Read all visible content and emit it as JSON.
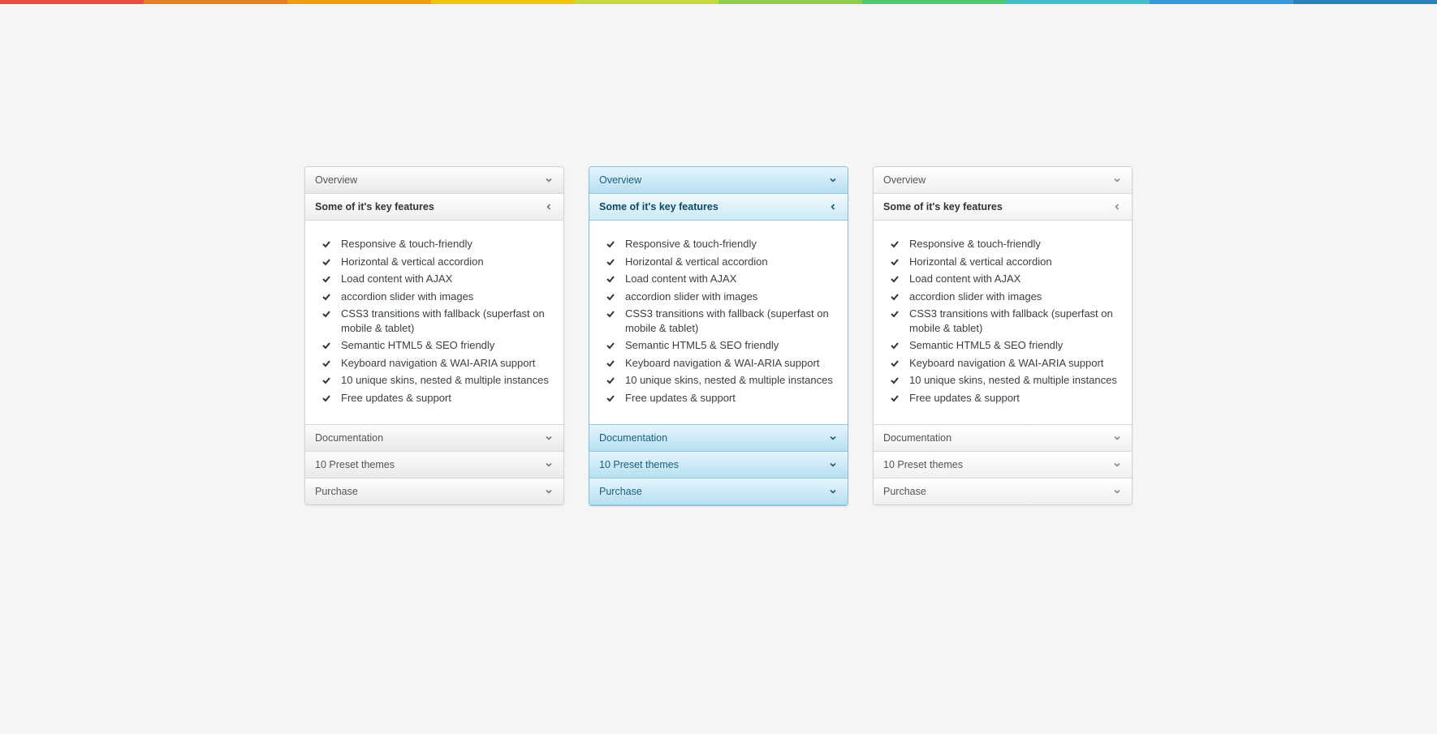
{
  "rainbow_colors": [
    "#e74c3c",
    "#e67e22",
    "#f39c12",
    "#f1c40f",
    "#c6d93b",
    "#8fce4b",
    "#4ecb71",
    "#3fc1c9",
    "#3498db",
    "#2980b9"
  ],
  "accordions": [
    {
      "skin": "white"
    },
    {
      "skin": "blue"
    },
    {
      "skin": "light"
    }
  ],
  "headers": {
    "overview": "Overview",
    "features": "Some of it's key features",
    "documentation": "Documentation",
    "themes": "10 Preset themes",
    "purchase": "Purchase"
  },
  "features": [
    "Responsive & touch-friendly",
    "Horizontal & vertical accordion",
    "Load content with AJAX",
    "accordion slider with images",
    "CSS3 transitions with fallback (superfast on mobile & tablet)",
    "Semantic HTML5 & SEO friendly",
    "Keyboard navigation & WAI-ARIA support",
    "10 unique skins, nested & multiple instances",
    "Free updates & support"
  ]
}
